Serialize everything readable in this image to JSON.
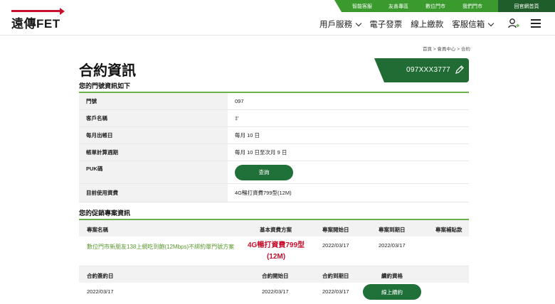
{
  "topbar": {
    "links": [
      "智能客服",
      "友善專區",
      "數位門市",
      "我們門市"
    ],
    "home": "回官網首頁"
  },
  "logo": {
    "text": "遠傳FET"
  },
  "nav": {
    "items": [
      "用戶服務",
      "電子發票",
      "線上繳款",
      "客服信箱"
    ]
  },
  "breadcrumb": "首頁 > 會員中心 > 合約",
  "page_title": "合約資訊",
  "phone": "097XXX3777",
  "info": {
    "section_title": "您的門號資訊如下",
    "rows": [
      {
        "label": "門號",
        "value": "097"
      },
      {
        "label": "客戶名稱",
        "value": "‡'"
      },
      {
        "label": "每月出帳日",
        "value": "每月 10 日"
      },
      {
        "label": "帳單計算週期",
        "value": "每月 10 日至次月 9 日"
      },
      {
        "label": "PUK碼",
        "button": "查詢"
      },
      {
        "label": "目前使用資費",
        "value": "4G暢打資費799型(12M)"
      }
    ]
  },
  "promo": {
    "section_title": "您的促銷專案資訊",
    "headers": [
      "專案名稱",
      "基本資費方案",
      "專案開始日",
      "專案到期日",
      "專案補貼款"
    ],
    "row": {
      "name": "數位門市新朋友138上網吃到飽(12Mbps)不綁約單門號方案",
      "plan": "4G暢打資費799型(12M)",
      "start": "2022/03/17",
      "end": "2022/03/17",
      "subsidy": ""
    },
    "contract_headers": [
      "合約簽約日",
      "合約開始日",
      "合約到期日",
      "續約資格"
    ],
    "contract_row": {
      "signed": "2022/03/17",
      "start": "2022/03/17",
      "end": "2022/03/17",
      "button": "線上續約"
    }
  }
}
